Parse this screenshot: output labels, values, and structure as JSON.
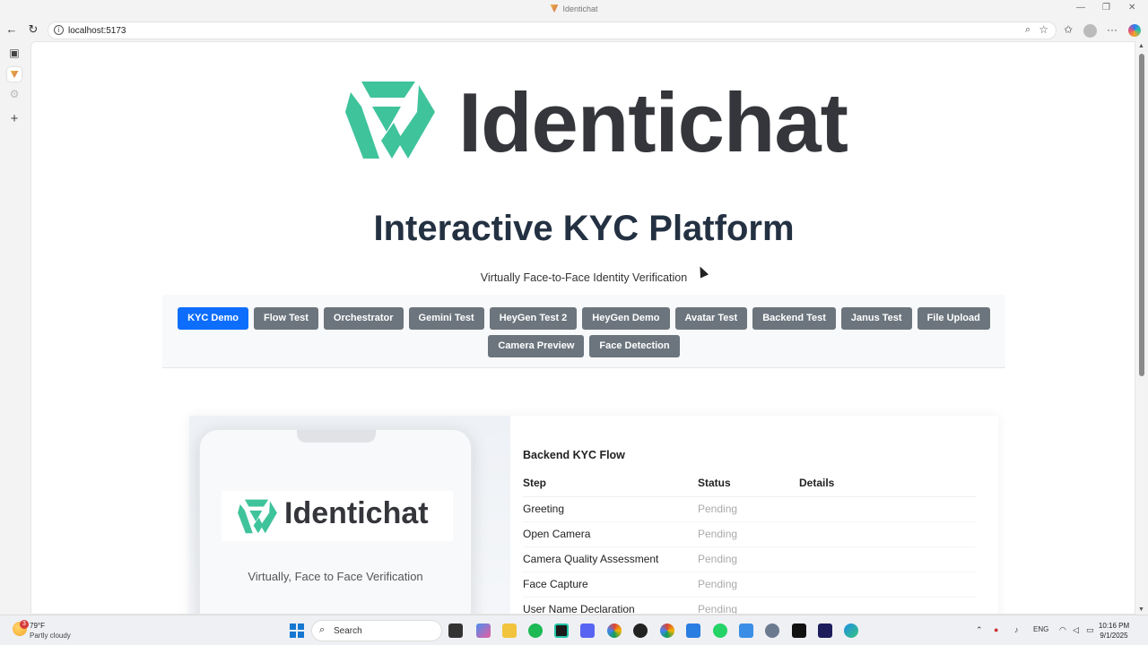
{
  "window": {
    "title": "Identichat",
    "min": "—",
    "restore": "❐",
    "close": "✕"
  },
  "address": {
    "url": "localhost:5173",
    "back": "←",
    "reload": "↻",
    "info": "i",
    "zoom": "⌕",
    "favorite": "☆",
    "collections": "✩",
    "more": "···"
  },
  "sidebar": {
    "tabs": "▣",
    "settings": "⚙",
    "add": "+"
  },
  "brand": {
    "name": "Identichat",
    "mark_color": "#3fc39b",
    "text_color": "#34363b"
  },
  "page": {
    "headline": "Interactive KYC Platform",
    "subline": "Virtually Face-to-Face Identity Verification",
    "nav_row1": [
      "KYC Demo",
      "Flow Test",
      "Orchestrator",
      "Gemini Test",
      "HeyGen Test 2",
      "HeyGen Demo",
      "Avatar Test",
      "Backend Test",
      "Janus Test",
      "File Upload"
    ],
    "nav_row2": [
      "Camera Preview",
      "Face Detection"
    ],
    "active_nav": "KYC Demo"
  },
  "phone": {
    "brand": "Identichat",
    "tagline": "Virtually, Face to Face Verification"
  },
  "flow": {
    "title": "Backend KYC Flow",
    "headers": [
      "Step",
      "Status",
      "Details"
    ],
    "rows": [
      {
        "step": "Greeting",
        "status": "Pending",
        "details": ""
      },
      {
        "step": "Open Camera",
        "status": "Pending",
        "details": ""
      },
      {
        "step": "Camera Quality Assessment",
        "status": "Pending",
        "details": ""
      },
      {
        "step": "Face Capture",
        "status": "Pending",
        "details": ""
      },
      {
        "step": "User Name Declaration",
        "status": "Pending",
        "details": ""
      }
    ]
  },
  "taskbar": {
    "weather_temp": "79°F",
    "weather_desc": "Partly cloudy",
    "weather_badge": "3",
    "search": "Search",
    "lang": "ENG",
    "time": "10:16 PM",
    "date": "9/1/2025"
  }
}
